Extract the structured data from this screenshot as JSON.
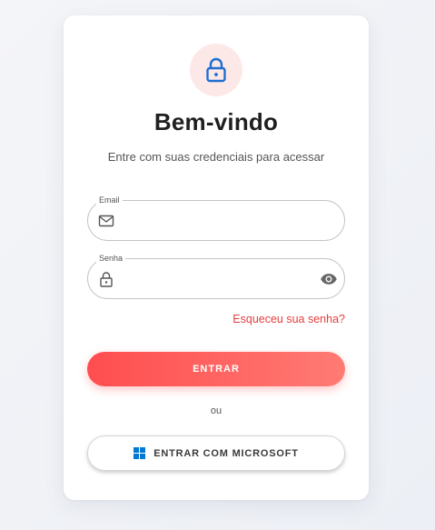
{
  "header": {
    "title": "Bem-vindo",
    "subtitle": "Entre com suas credenciais para acessar",
    "icon": "lock-icon"
  },
  "form": {
    "email": {
      "label": "Email",
      "value": "",
      "placeholder": "",
      "icon": "mail-icon"
    },
    "password": {
      "label": "Senha",
      "value": "",
      "placeholder": "",
      "icon": "lock-icon",
      "toggle_icon": "eye-icon"
    },
    "forgot_link": "Esqueceu sua senha?",
    "submit_label": "ENTRAR",
    "divider": "ou",
    "microsoft_label": "ENTRAR COM MICROSOFT"
  },
  "colors": {
    "accent": "#ff4d4f",
    "accent_light": "#ff7b74",
    "link": "#e53e3e",
    "lock_blue": "#1e6fd0",
    "badge_bg": "#fde8e8",
    "ms_blue": "#0078d4"
  }
}
